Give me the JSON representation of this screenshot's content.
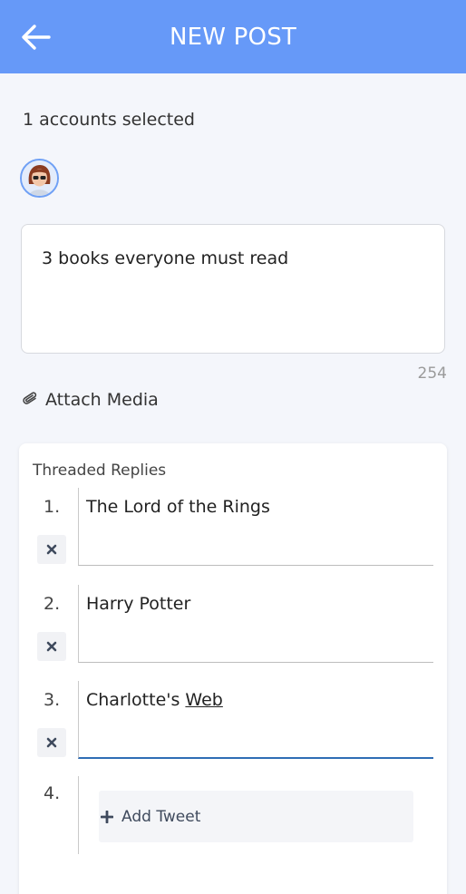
{
  "header": {
    "title": "NEW POST",
    "back_icon": "arrow-left-icon"
  },
  "accounts": {
    "label": "1 accounts selected"
  },
  "compose": {
    "text": "3 books everyone must read",
    "char_count": "254"
  },
  "attach": {
    "label": "Attach Media",
    "icon": "paperclip-icon"
  },
  "threaded": {
    "title": "Threaded Replies",
    "replies": [
      {
        "number": "1.",
        "text": "The Lord of the Rings"
      },
      {
        "number": "2.",
        "text": "Harry Potter"
      },
      {
        "number": "3.",
        "text_before": "Charlotte's ",
        "text_underlined": "Web"
      }
    ],
    "add": {
      "number": "4.",
      "label": "Add Tweet"
    }
  },
  "colors": {
    "header": "#6699f8",
    "active_underline": "#2f6db5"
  }
}
